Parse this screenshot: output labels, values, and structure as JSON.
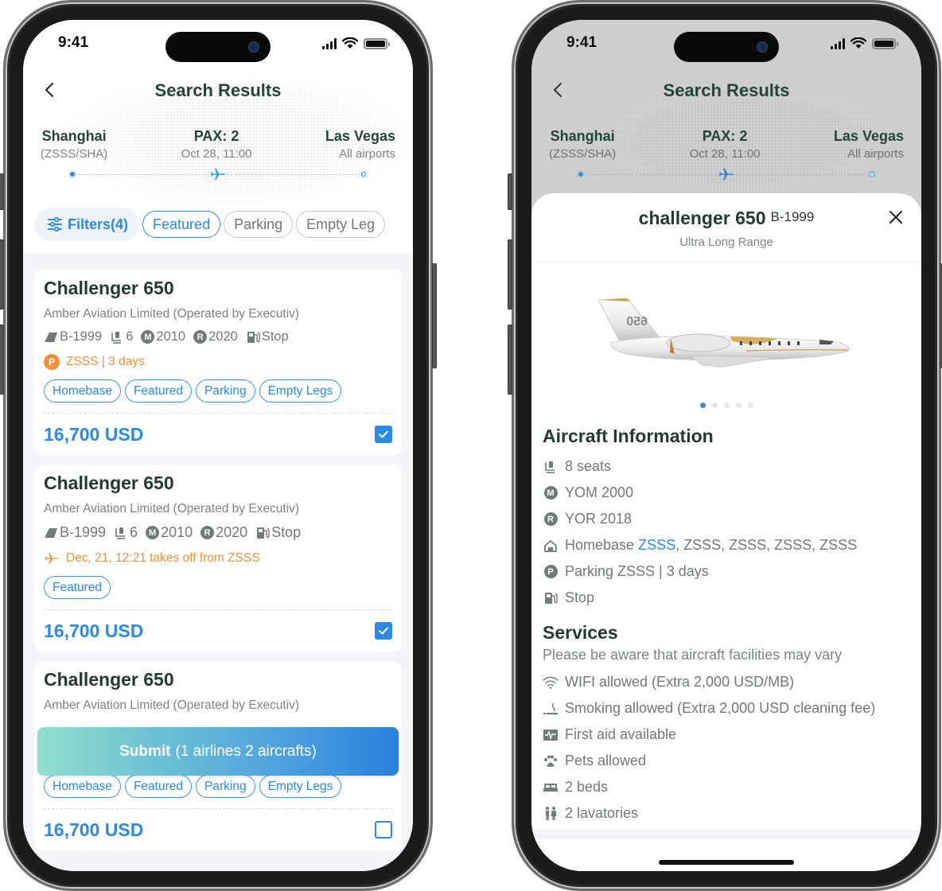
{
  "status_bar": {
    "time": "9:41"
  },
  "header": {
    "title": "Search Results",
    "origin": {
      "city": "Shanghai",
      "code": "(ZSSS/SHA)"
    },
    "middle": {
      "pax": "PAX: 2",
      "datetime": "Oct 28, 11:00"
    },
    "destination": {
      "city": "Las Vegas",
      "code": "All airports"
    }
  },
  "filters": {
    "filter_button": "Filters(4)",
    "chips": [
      {
        "label": "Featured",
        "active": true
      },
      {
        "label": "Parking",
        "active": false
      },
      {
        "label": "Empty Leg",
        "active": false
      }
    ]
  },
  "results": [
    {
      "title": "Challenger 650",
      "operator": "Amber Aviation Limited (Operated by Executiv)",
      "registration": "B-1999",
      "seats": "6",
      "yom": "2010",
      "yor": "2020",
      "fuel": "Stop",
      "note_icon": "parking-icon",
      "note": "ZSSS | 3 days",
      "tags": [
        "Homebase",
        "Featured",
        "Parking",
        "Empty Legs"
      ],
      "price": "16,700 USD",
      "selected": true
    },
    {
      "title": "Challenger 650",
      "operator": "Amber Aviation Limited (Operated by Executiv)",
      "registration": "B-1999",
      "seats": "6",
      "yom": "2010",
      "yor": "2020",
      "fuel": "Stop",
      "note_icon": "plane-icon",
      "note": "Dec, 21, 12:21 takes off from ZSSS",
      "tags": [
        "Featured"
      ],
      "price": "16,700 USD",
      "selected": true
    },
    {
      "title": "Challenger 650",
      "operator": "Amber Aviation Limited (Operated by Executiv)",
      "tags": [
        "Homebase",
        "Featured",
        "Parking",
        "Empty Legs"
      ],
      "price": "16,700 USD",
      "selected": false
    }
  ],
  "submit": {
    "label": "Submit",
    "detail": "(1 airlines 2 aircrafts)"
  },
  "detail_sheet": {
    "title": "challenger 650",
    "registration": "B-1999",
    "category": "Ultra Long Range",
    "gallery": {
      "total": 5,
      "current": 1
    },
    "aircraft_info": {
      "heading": "Aircraft Information",
      "seats": "8 seats",
      "yom": "YOM 2000",
      "yor": "YOR 2018",
      "homebase_label": "Homebase",
      "homebase_primary": "ZSSS,",
      "homebase_others": "ZSSS, ZSSS, ZSSS, ZSSS",
      "parking": "Parking ZSSS | 3 days",
      "fuel": "Stop"
    },
    "services": {
      "heading": "Services",
      "note": "Please be aware that aircraft facilities may vary",
      "items": [
        {
          "icon": "wifi-icon",
          "label": "WIFI allowed (Extra 2,000 USD/MB)"
        },
        {
          "icon": "smoking-icon",
          "label": "Smoking allowed (Extra 2,000 USD cleaning fee)"
        },
        {
          "icon": "first-aid-icon",
          "label": "First aid available"
        },
        {
          "icon": "paw-icon",
          "label": "Pets allowed"
        },
        {
          "icon": "bed-icon",
          "label": "2 beds"
        },
        {
          "icon": "lavatory-icon",
          "label": "2 lavatories"
        }
      ]
    }
  },
  "colors": {
    "accent": "#2a8ae6",
    "warning": "#f0913a",
    "heading": "#233a33",
    "muted": "#7b8581"
  }
}
